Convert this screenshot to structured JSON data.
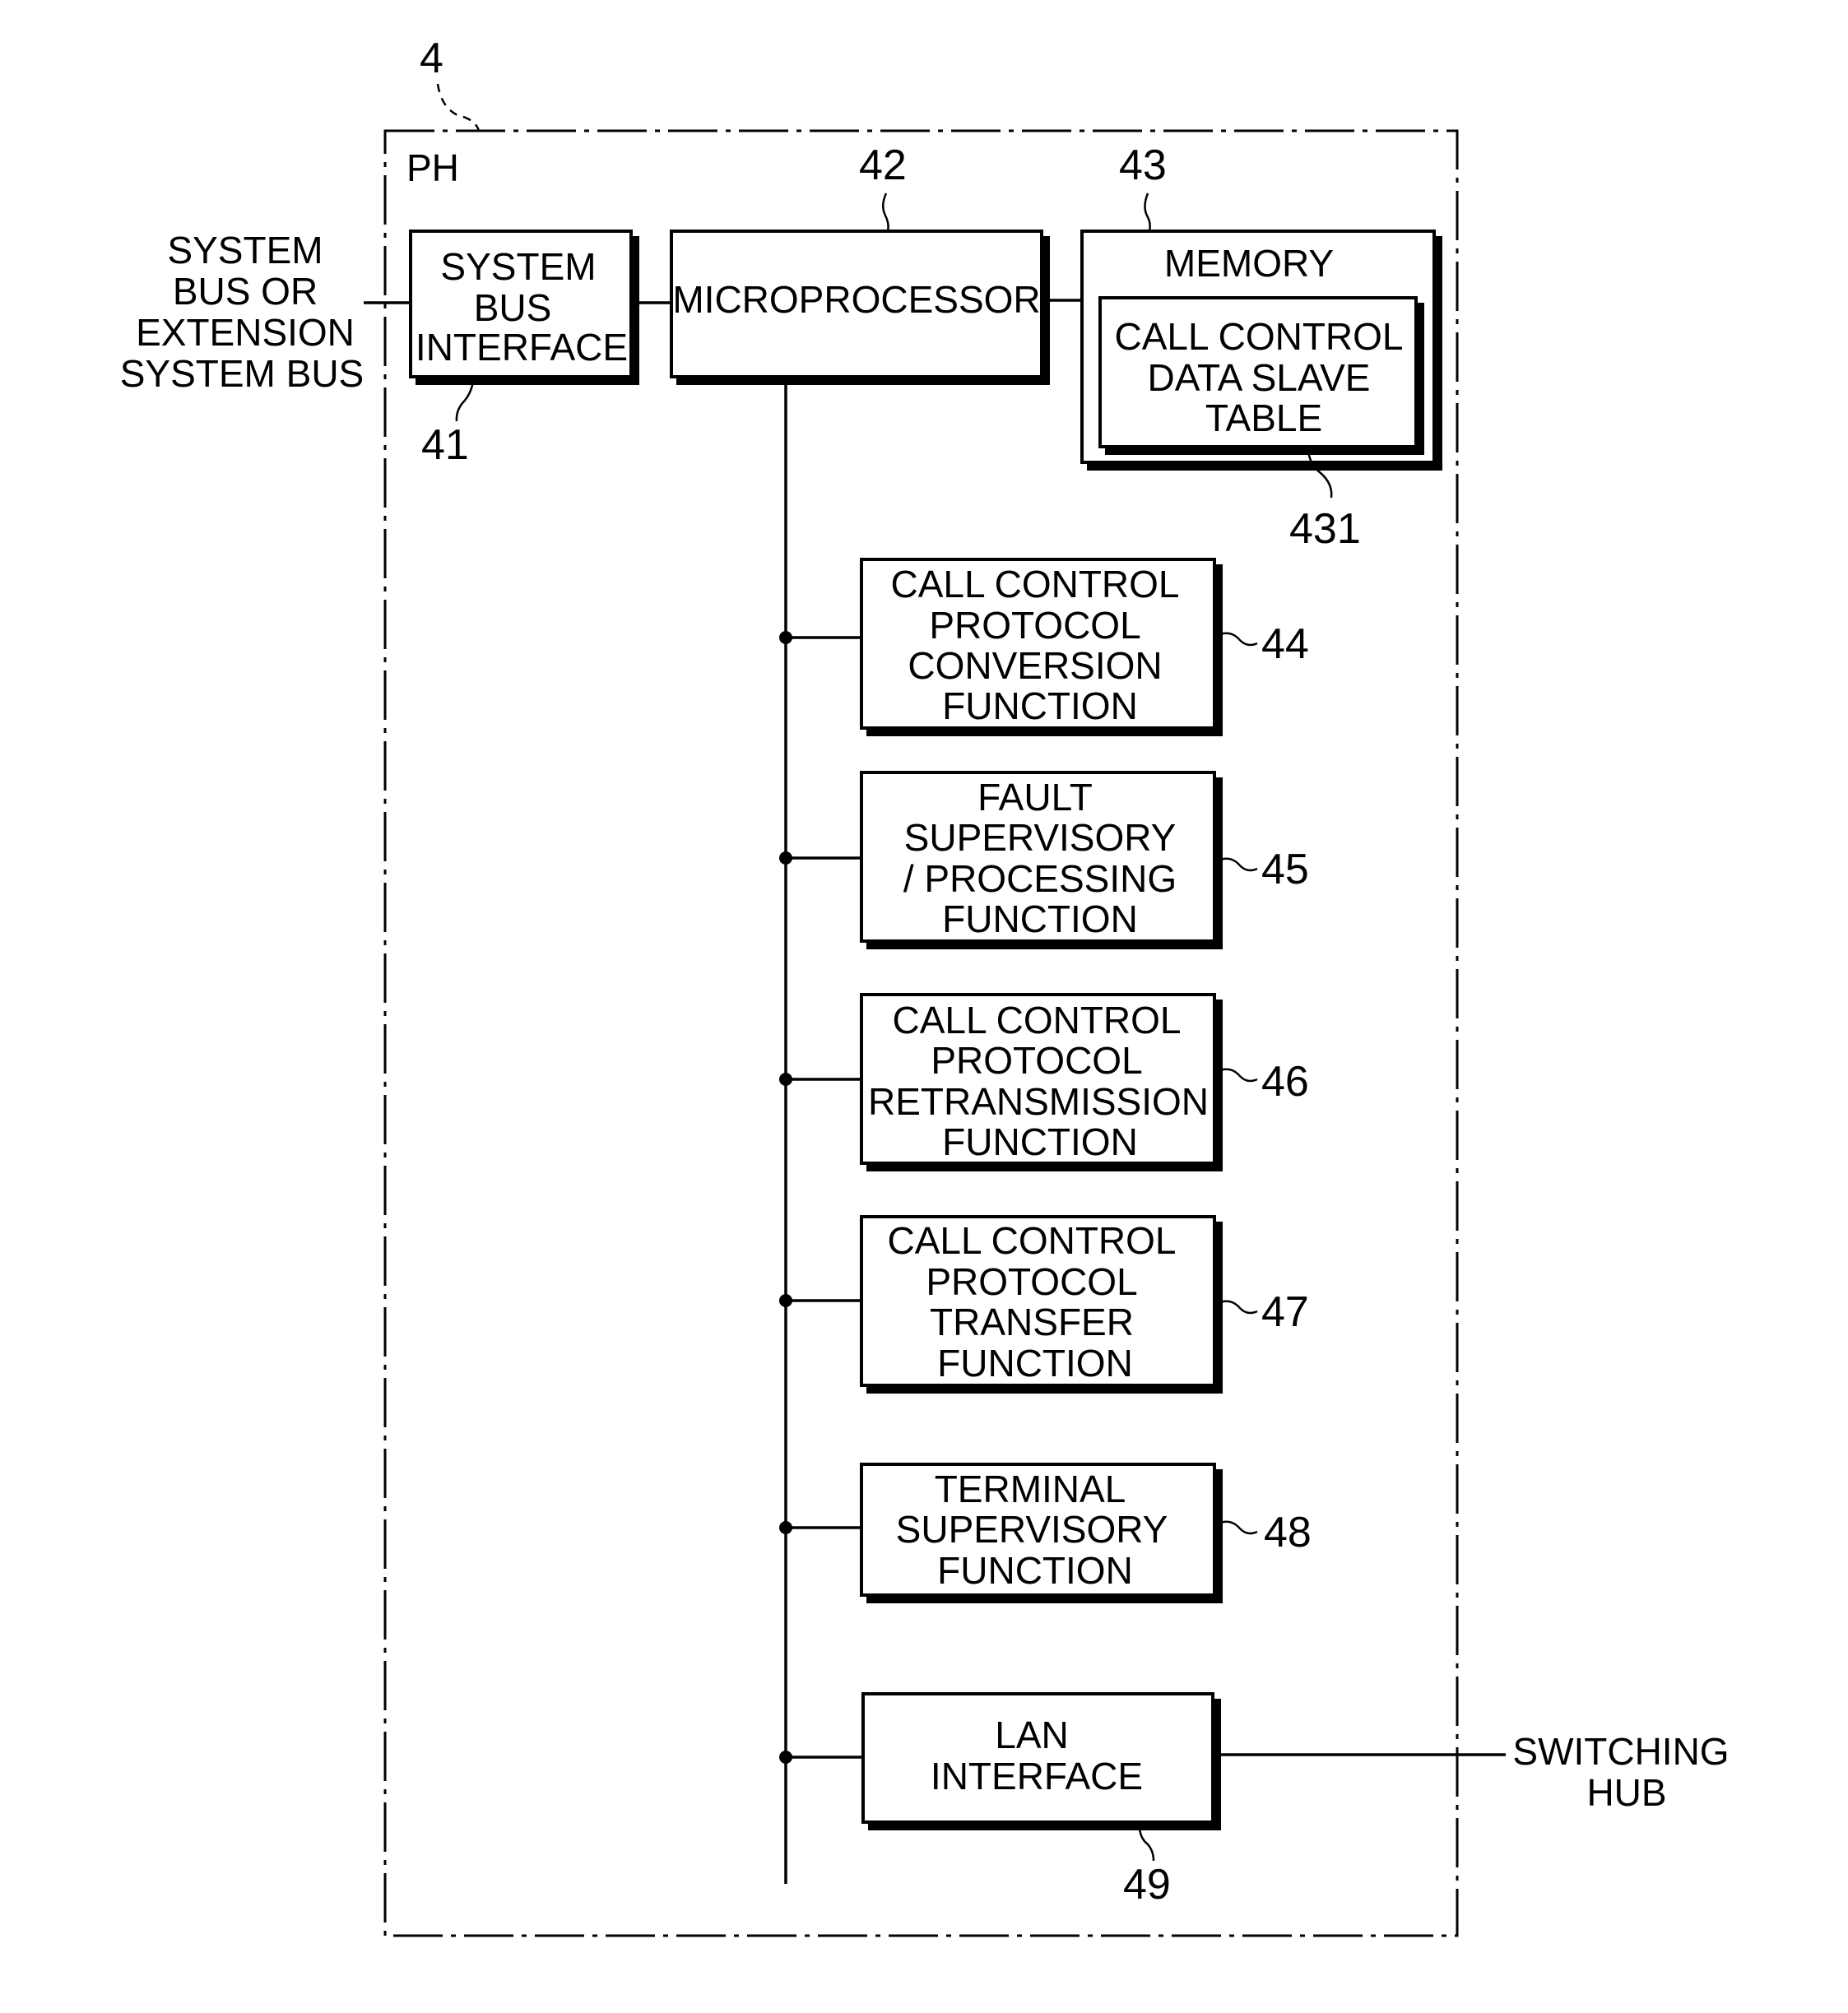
{
  "diagram": {
    "figure_ref": "4",
    "container_label": "PH",
    "external_left": {
      "lines": [
        "SYSTEM",
        "BUS OR",
        "EXTENSION",
        "SYSTEM BUS"
      ]
    },
    "external_right": {
      "lines": [
        "SWITCHING",
        "HUB"
      ]
    },
    "blocks": {
      "system_bus_interface": {
        "ref": "41",
        "lines": [
          "SYSTEM",
          "BUS",
          "INTERFACE"
        ]
      },
      "microprocessor": {
        "ref": "42",
        "lines": [
          "MICROPROCESSOR"
        ]
      },
      "memory": {
        "ref": "43",
        "lines": [
          "MEMORY"
        ]
      },
      "call_control_data_slave_table": {
        "ref": "431",
        "lines": [
          "CALL CONTROL",
          "DATA SLAVE",
          "TABLE"
        ]
      },
      "conversion": {
        "ref": "44",
        "lines": [
          "CALL CONTROL",
          "PROTOCOL",
          "CONVERSION",
          "FUNCTION"
        ]
      },
      "fault": {
        "ref": "45",
        "lines": [
          "FAULT",
          "SUPERVISORY",
          "/ PROCESSING",
          "FUNCTION"
        ]
      },
      "retransmission": {
        "ref": "46",
        "lines": [
          "CALL CONTROL",
          "PROTOCOL",
          "RETRANSMISSION",
          "FUNCTION"
        ]
      },
      "transfer": {
        "ref": "47",
        "lines": [
          "CALL CONTROL",
          "PROTOCOL",
          "TRANSFER",
          "FUNCTION"
        ]
      },
      "terminal": {
        "ref": "48",
        "lines": [
          "TERMINAL",
          "SUPERVISORY",
          "FUNCTION"
        ]
      },
      "lan_interface": {
        "ref": "49",
        "lines": [
          "LAN",
          "INTERFACE"
        ]
      }
    }
  }
}
